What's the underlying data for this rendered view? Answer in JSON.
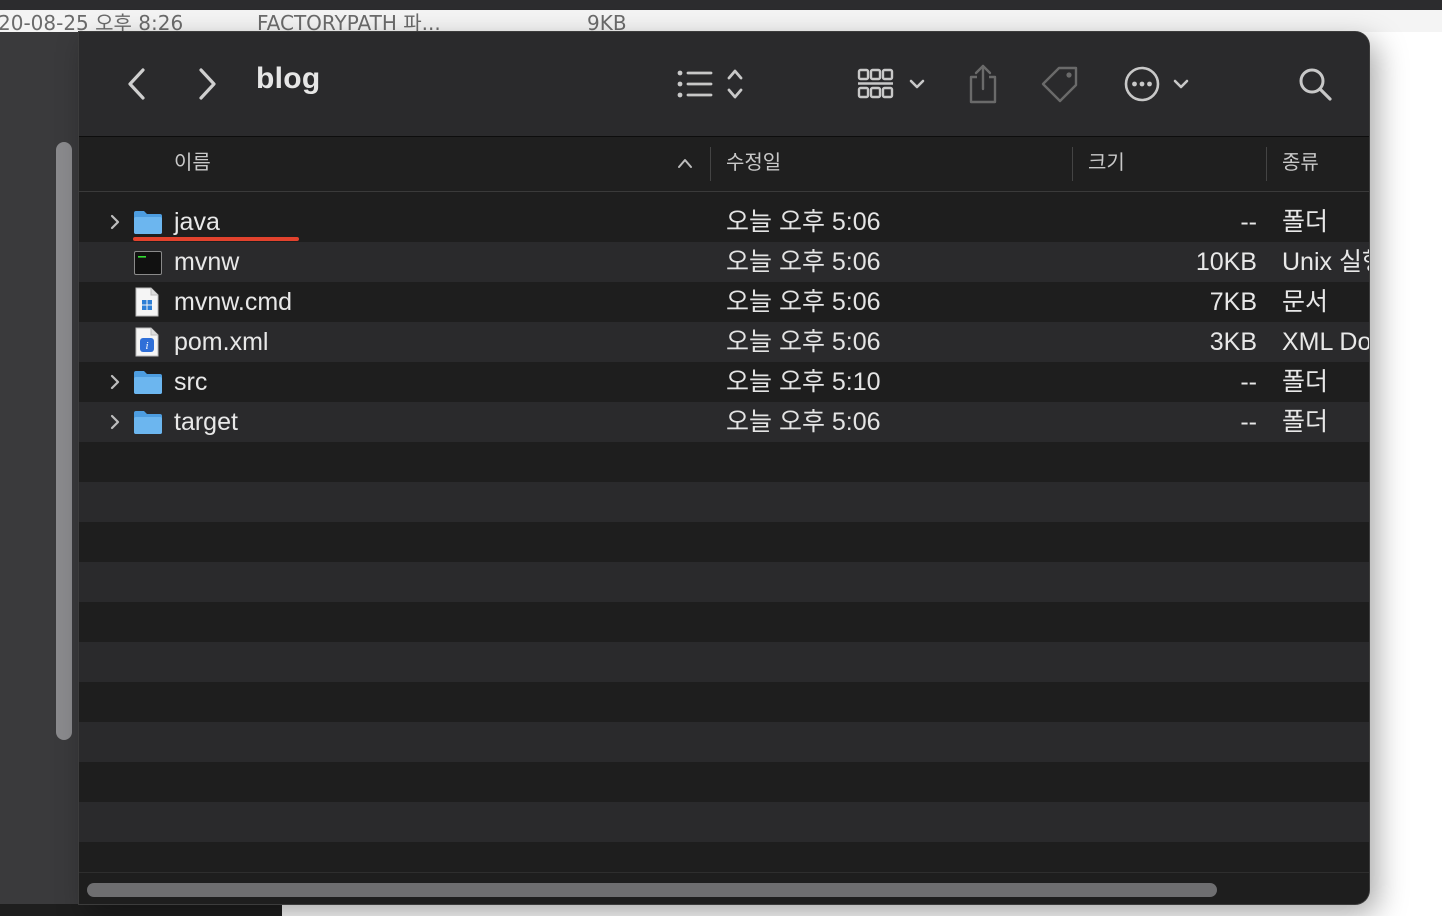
{
  "background_app": {
    "row_date": "20-08-25 오후 8:26",
    "row_name": "FACTORYPATH 파...",
    "row_size": "9KB"
  },
  "toolbar": {
    "title": "blog",
    "back_icon": "chevron-left-icon",
    "forward_icon": "chevron-right-icon",
    "view_icon": "list-view-icon",
    "group_icon": "grid-group-icon",
    "share_icon": "share-icon",
    "tag_icon": "tag-icon",
    "more_icon": "ellipsis-circle-icon",
    "search_icon": "search-icon"
  },
  "columns": {
    "name": "이름",
    "modified": "수정일",
    "size": "크기",
    "kind": "종류",
    "sort": "ascending"
  },
  "files": [
    {
      "name": "java",
      "icon": "folder-icon",
      "modified": "오늘 오후 5:06",
      "size": "--",
      "kind": "폴더",
      "expandable": true,
      "underlined": true
    },
    {
      "name": "mvnw",
      "icon": "terminal-file-icon",
      "modified": "오늘 오후 5:06",
      "size": "10KB",
      "kind": "Unix 실행",
      "expandable": false
    },
    {
      "name": "mvnw.cmd",
      "icon": "windows-cmd-file-icon",
      "modified": "오늘 오후 5:06",
      "size": "7KB",
      "kind": "문서",
      "expandable": false
    },
    {
      "name": "pom.xml",
      "icon": "xml-file-icon",
      "modified": "오늘 오후 5:06",
      "size": "3KB",
      "kind": "XML Document",
      "expandable": false
    },
    {
      "name": "src",
      "icon": "folder-icon",
      "modified": "오늘 오후 5:10",
      "size": "--",
      "kind": "폴더",
      "expandable": true
    },
    {
      "name": "target",
      "icon": "folder-icon",
      "modified": "오늘 오후 5:06",
      "size": "--",
      "kind": "폴더",
      "expandable": true
    }
  ],
  "colors": {
    "accent_underline": "#e2422d",
    "folder": "#5aa9e6",
    "window_bg": "#1e1e1e",
    "row_alt": "#2a2a2c"
  }
}
